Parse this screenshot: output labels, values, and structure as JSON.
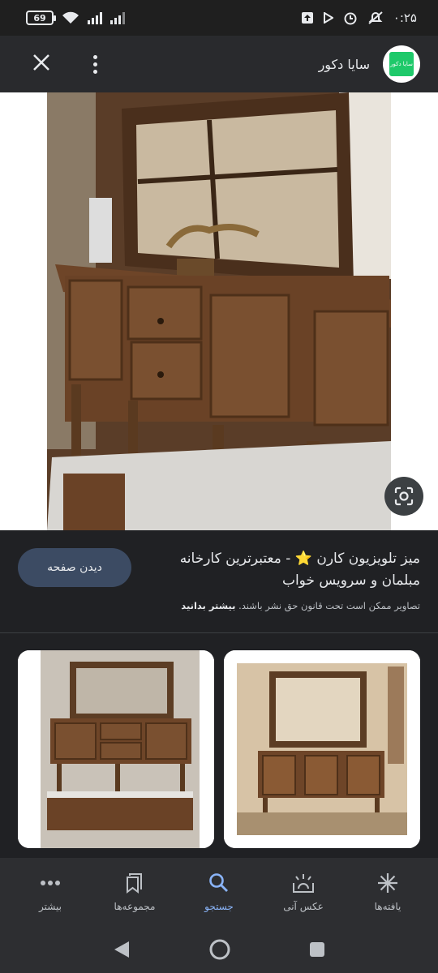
{
  "status_bar": {
    "battery": "69",
    "time": "۰:۲۵"
  },
  "header": {
    "site_name": "سایا دکور",
    "logo_text": "سایا دکور"
  },
  "result": {
    "title": "میز تلویزیون کارن ⭐ - معتبرترین کارخانه مبلمان و سرویس خواب",
    "visit_label": "دیدن صفحه",
    "notice": "تصاویر ممکن است تحت قانون حق نشر باشند.",
    "notice_link": "بیشتر بدانید"
  },
  "bottom_nav": [
    {
      "label": "بیشتر",
      "icon": "more-dots-icon"
    },
    {
      "label": "مجموعه‌ها",
      "icon": "collections-icon"
    },
    {
      "label": "جستجو",
      "icon": "search-icon",
      "active": true
    },
    {
      "label": "عکس آنی",
      "icon": "snapshot-icon"
    },
    {
      "label": "یافته‌ها",
      "icon": "discover-icon"
    }
  ],
  "colors": {
    "background": "#202124",
    "accent": "#8ab4f8",
    "button": "#3c4b63"
  }
}
